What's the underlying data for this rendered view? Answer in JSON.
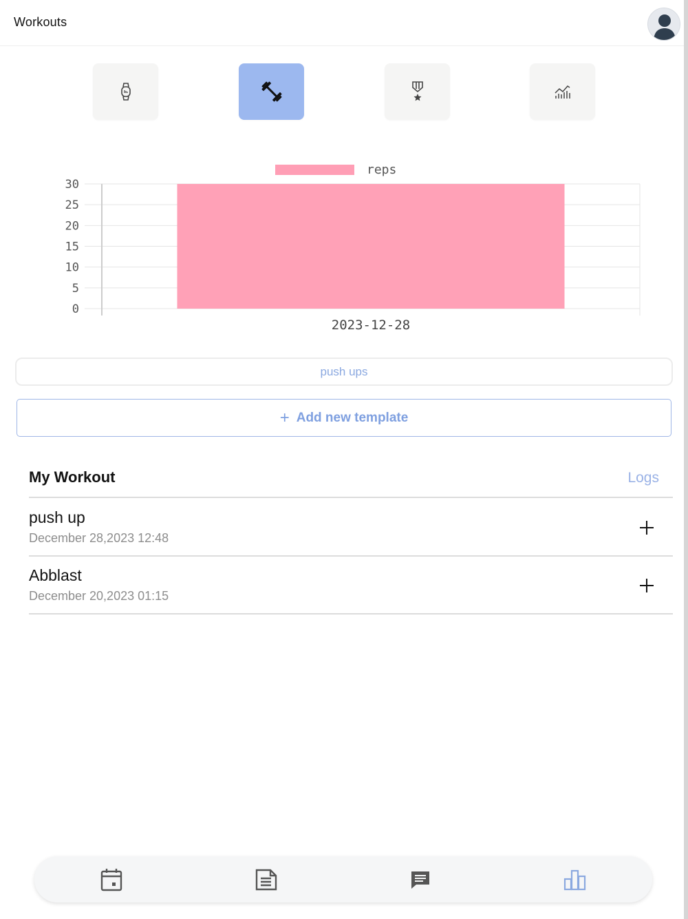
{
  "header": {
    "title": "Workouts"
  },
  "tabs": [
    {
      "icon": "smartwatch-icon",
      "active": false
    },
    {
      "icon": "dumbbell-icon",
      "active": true
    },
    {
      "icon": "medal-icon",
      "active": false
    },
    {
      "icon": "stats-chart-icon",
      "active": false
    }
  ],
  "chart_data": {
    "type": "bar",
    "categories": [
      "2023-12-28"
    ],
    "series": [
      {
        "name": "reps",
        "values": [
          30
        ],
        "color": "#ff9eb5"
      }
    ],
    "yticks": [
      "30",
      "25",
      "20",
      "15",
      "10",
      "5",
      "0"
    ],
    "ylim": [
      0,
      30
    ],
    "grid": true,
    "legend": "top"
  },
  "exercise_filter": {
    "label": "push ups"
  },
  "add_template": {
    "label": "Add new template"
  },
  "workouts": {
    "title": "My Workout",
    "logs_label": "Logs",
    "items": [
      {
        "name": "push up",
        "date": "December 28,2023 12:48"
      },
      {
        "name": "Abblast",
        "date": "December 20,2023 01:15"
      }
    ]
  },
  "bottom_nav": [
    {
      "icon": "calendar-icon",
      "active": false
    },
    {
      "icon": "document-icon",
      "active": false
    },
    {
      "icon": "chat-icon",
      "active": false
    },
    {
      "icon": "bar-chart-icon",
      "active": true
    }
  ],
  "colors": {
    "accent": "#9cb8ef",
    "bar": "#ff9eb5",
    "link": "#9ab2e6"
  }
}
